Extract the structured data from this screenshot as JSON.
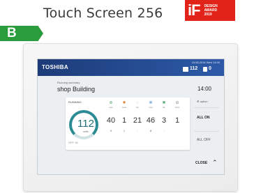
{
  "header": {
    "product_title": "Touch Screen 256",
    "award": {
      "logo": "iF",
      "line1": "DESIGN",
      "line2": "AWARD",
      "line3": "2019"
    },
    "badge_letter": "B"
  },
  "screen": {
    "brand": "TOSHIBA",
    "datetime": "15.08.2018 Wed 14:00",
    "icons": {
      "left": "monitor-icon",
      "right": "alert-icon"
    },
    "count_value": "112",
    "alert_value": "0",
    "summary_label": "Running summary",
    "building": "shop Building",
    "time": "14:00",
    "running_label": "RUNNING",
    "gauge": {
      "value": "112",
      "unit": "units",
      "sub": "OFF 16"
    },
    "modes": [
      {
        "icon": "auto-icon",
        "glyph": "⊛",
        "label": "auto",
        "count": "40",
        "sub": "5",
        "color": "#5aa96b"
      },
      {
        "icon": "heat-icon",
        "glyph": "✹",
        "label": "heat",
        "count": "1",
        "sub": "1",
        "color": "#e4883a"
      },
      {
        "icon": "dry-icon",
        "glyph": "◌",
        "label": "dry",
        "count": "21",
        "sub": "-",
        "color": "#5a9ed6"
      },
      {
        "icon": "cool-icon",
        "glyph": "✲",
        "label": "cool",
        "count": "46",
        "sub": "8",
        "color": "#3c7fc8"
      },
      {
        "icon": "fan-icon",
        "glyph": "✖",
        "label": "fan",
        "count": "3",
        "sub": "-",
        "color": "#4aa56b"
      },
      {
        "icon": "other-icon",
        "glyph": "⊖",
        "label": "other",
        "count": "1",
        "sub": "",
        "color": "#888888"
      }
    ],
    "option_label": "option",
    "all_on": "ALL ON",
    "all_off": "ALL OFF",
    "close_label": "CLOSE"
  }
}
